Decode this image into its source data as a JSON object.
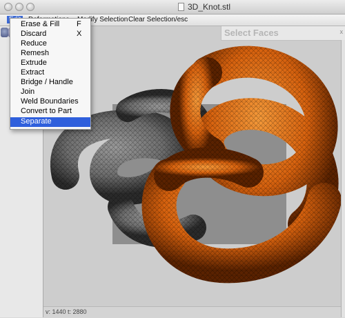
{
  "window": {
    "title": "3D_Knot.stl"
  },
  "menubar": {
    "edit": "Edit",
    "deformations": "Deformations",
    "modify_selection": "Modify Selection",
    "clear_selection": "Clear Selection/esc"
  },
  "edit_menu": {
    "items": [
      {
        "label": "Erase & Fill",
        "shortcut": "F"
      },
      {
        "label": "Discard",
        "shortcut": "X"
      },
      {
        "label": "Reduce"
      },
      {
        "label": "Remesh"
      },
      {
        "label": "Extrude"
      },
      {
        "label": "Extract"
      },
      {
        "label": "Bridge / Handle"
      },
      {
        "label": "Join"
      },
      {
        "label": "Weld Boundaries"
      },
      {
        "label": "Convert to Part"
      },
      {
        "label": "Separate",
        "selected": true
      }
    ]
  },
  "panel": {
    "title": "Select Faces",
    "close": "x"
  },
  "status": {
    "text": "v: 1440  t: 2880"
  },
  "colors": {
    "selected_item": "#2f5fdc",
    "gray_knot": "#6f6f6f",
    "orange_knot": "#d8620e",
    "viewport_bg": "#cdcdcd"
  },
  "icons": [
    "close-icon",
    "minimize-icon",
    "zoom-icon",
    "document-icon",
    "tool-icon",
    "tool-icon"
  ]
}
